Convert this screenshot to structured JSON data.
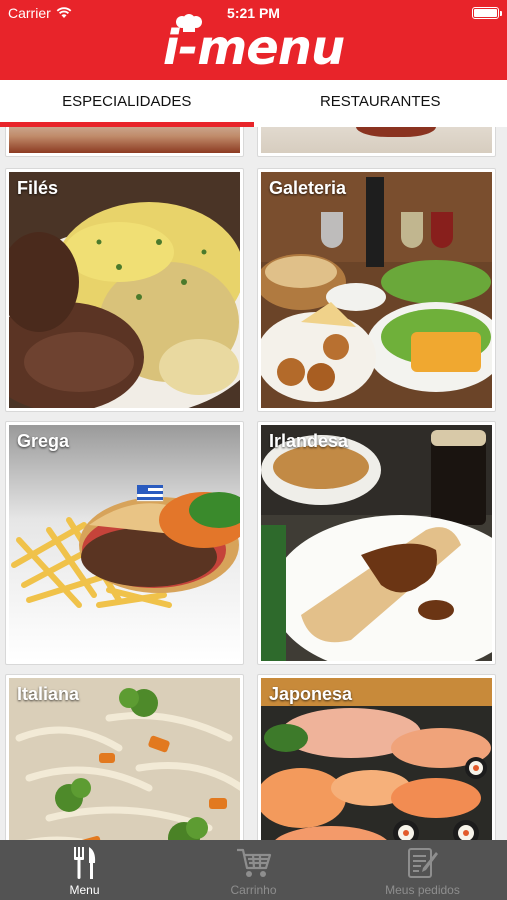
{
  "status": {
    "carrier": "Carrier",
    "time": "5:21 PM"
  },
  "header": {
    "logo": "i-menu",
    "color": "#e8242a"
  },
  "tabs": [
    {
      "label": "ESPECIALIDADES",
      "active": true
    },
    {
      "label": "RESTAURANTES",
      "active": false
    }
  ],
  "categories": [
    {
      "name": "Filés"
    },
    {
      "name": "Galeteria"
    },
    {
      "name": "Grega"
    },
    {
      "name": "Irlandesa"
    },
    {
      "name": "Italiana"
    },
    {
      "name": "Japonesa"
    }
  ],
  "tabbar": {
    "items": [
      {
        "label": "Menu",
        "icon": "fork-knife-icon",
        "active": true
      },
      {
        "label": "Carrinho",
        "icon": "cart-icon",
        "active": false
      },
      {
        "label": "Meus pedidos",
        "icon": "orders-icon",
        "active": false
      }
    ],
    "active_color": "#ffffff",
    "inactive_color": "#8e8e8e"
  }
}
